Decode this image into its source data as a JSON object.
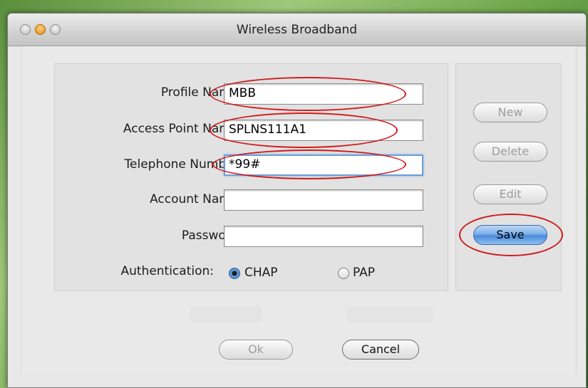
{
  "window": {
    "title": "Wireless Broadband"
  },
  "form": {
    "profile_name_label": "Profile Name:",
    "profile_name_value": "MBB",
    "apn_label": "Access Point Name:",
    "apn_value": "SPLNS111A1",
    "telephone_label": "Telephone Number:",
    "telephone_value": "*99#",
    "account_label": "Account Name:",
    "account_value": "",
    "password_label": "Password:",
    "password_value": "",
    "auth_label": "Authentication:",
    "auth_options": [
      "CHAP",
      "PAP"
    ],
    "auth_selected": "CHAP"
  },
  "side_buttons": {
    "new": "New",
    "delete": "Delete",
    "edit": "Edit",
    "save": "Save"
  },
  "footer": {
    "ok": "Ok",
    "cancel": "Cancel"
  },
  "colors": {
    "annotation": "#d01c1c",
    "accent_blue": "#4a8ad9"
  }
}
